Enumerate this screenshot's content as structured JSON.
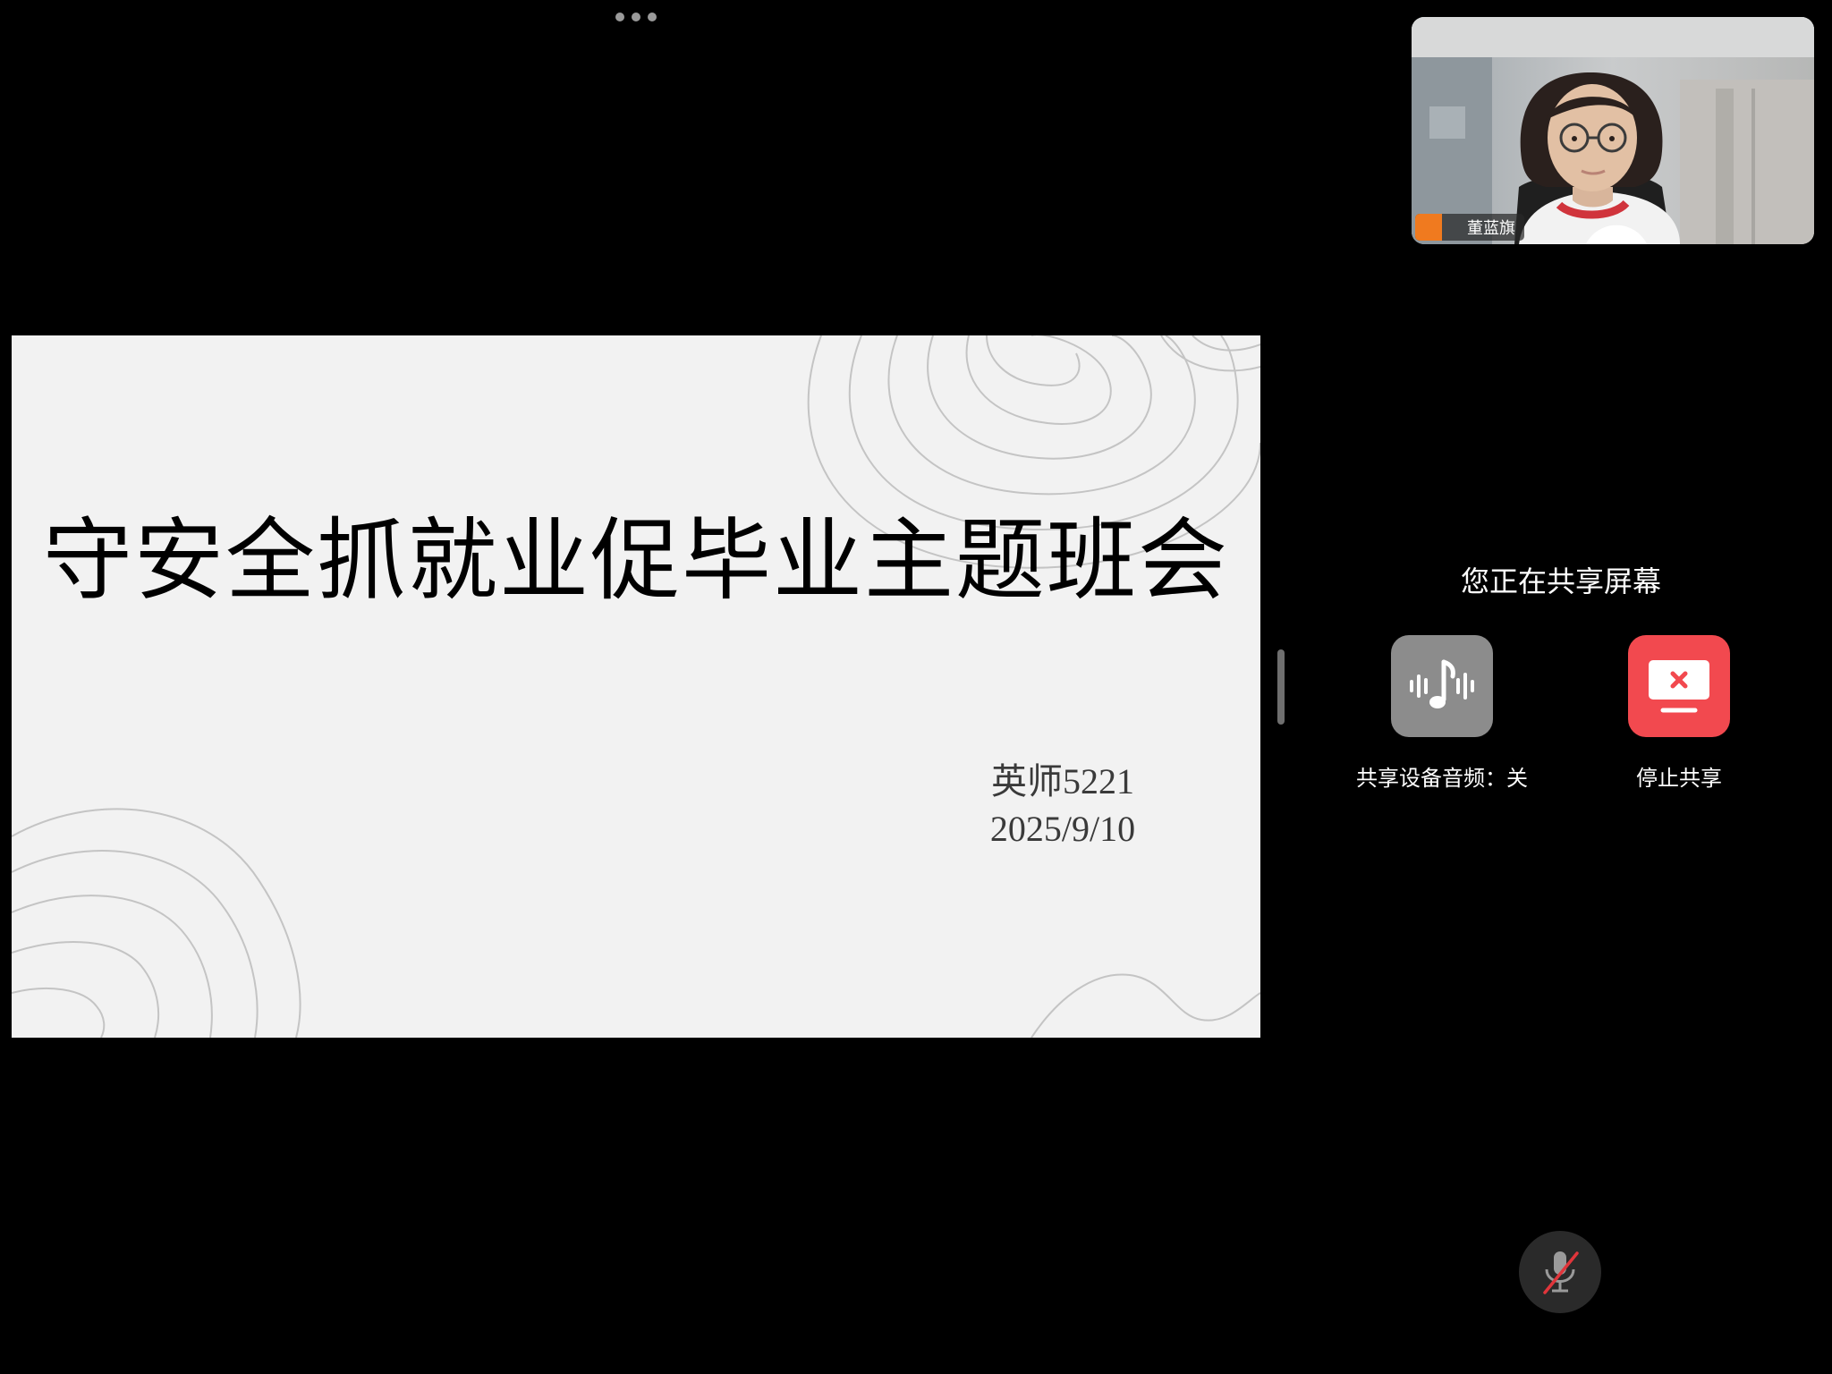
{
  "toolbar": {
    "more_icon": "more-horizontal-icon"
  },
  "slide": {
    "title": "守安全抓就业促毕业主题班会",
    "author": "英师5221",
    "date": "2025/9/10",
    "background_color": "#f2f2f2",
    "contour_color": "#c4c4c4"
  },
  "camera": {
    "participant_name": "董蓝旗",
    "badge_icon": "user-icon",
    "mic_icon": "microphone-icon",
    "badge_color": "#f07a1f"
  },
  "share_panel": {
    "heading": "您正在共享屏幕",
    "audio_button": {
      "label": "共享设备音频：关",
      "icon": "music-waveform-icon",
      "color": "#8c8c8c"
    },
    "stop_button": {
      "label": "停止共享",
      "icon": "stop-screen-share-icon",
      "color": "#f2494f"
    }
  },
  "mic_control": {
    "icon": "microphone-muted-icon",
    "state": "muted",
    "slash_color": "#e0353b"
  }
}
